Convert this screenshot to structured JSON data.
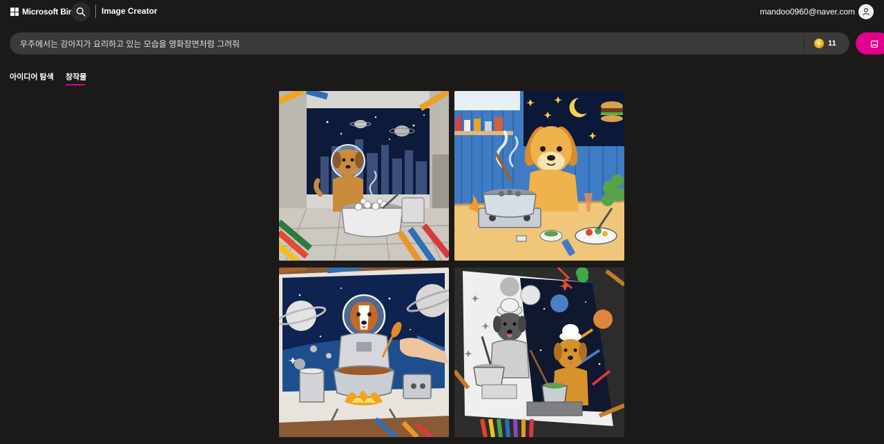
{
  "header": {
    "brand": "Microsoft Bing",
    "product": "Image Creator",
    "user_email": "mandoo0960@naver.com"
  },
  "prompt": {
    "text": "우주에서는 강아지가 요리하고 있는 모습을 영화장면처럼 그려줘",
    "boosts": "11"
  },
  "tabs": [
    {
      "label": "아이디어 탐색",
      "active": false
    },
    {
      "label": "창작물",
      "active": true
    }
  ],
  "icons": {
    "brand": "microsoft-logo-icon",
    "search": "search-icon",
    "user": "user-avatar-icon",
    "coin": "boost-coin-icon",
    "create": "create-image-icon"
  },
  "colors": {
    "background": "#1b1a19",
    "prompt_bar": "#3b3a39",
    "accent": "#e3008c",
    "coin": "#f2b81c"
  },
  "results": [
    {
      "name": "result-image-1"
    },
    {
      "name": "result-image-2"
    },
    {
      "name": "result-image-3"
    },
    {
      "name": "result-image-4"
    }
  ]
}
